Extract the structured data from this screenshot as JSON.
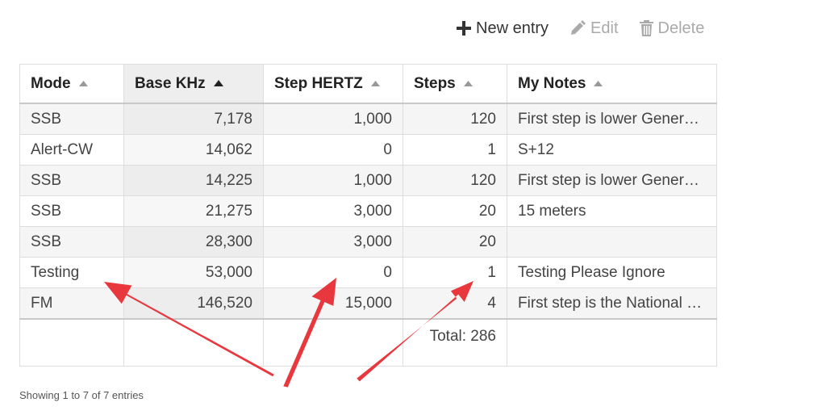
{
  "toolbar": {
    "new_entry": {
      "label": "New entry",
      "icon": "plus-icon"
    },
    "edit": {
      "label": "Edit",
      "icon": "pencil-icon"
    },
    "delete": {
      "label": "Delete",
      "icon": "trash-icon"
    }
  },
  "table": {
    "columns": [
      {
        "label": "Mode",
        "sort": "none"
      },
      {
        "label": "Base KHz",
        "sort": "ascending"
      },
      {
        "label": "Step HERTZ",
        "sort": "none"
      },
      {
        "label": "Steps",
        "sort": "none"
      },
      {
        "label": "My Notes",
        "sort": "none"
      }
    ],
    "rows": [
      {
        "mode": "SSB",
        "base": "7,178",
        "step": "1,000",
        "steps": "120",
        "notes": "First step is lower General Band Edge"
      },
      {
        "mode": "Alert-CW",
        "base": "14,062",
        "step": "0",
        "steps": "1",
        "notes": "S+12"
      },
      {
        "mode": "SSB",
        "base": "14,225",
        "step": "1,000",
        "steps": "120",
        "notes": "First step is lower General Band Edge"
      },
      {
        "mode": "SSB",
        "base": "21,275",
        "step": "3,000",
        "steps": "20",
        "notes": "15 meters"
      },
      {
        "mode": "SSB",
        "base": "28,300",
        "step": "3,000",
        "steps": "20",
        "notes": ""
      },
      {
        "mode": "Testing",
        "base": "53,000",
        "step": "0",
        "steps": "1",
        "notes": "Testing Please Ignore"
      },
      {
        "mode": "FM",
        "base": "146,520",
        "step": "15,000",
        "steps": "4",
        "notes": "First step is the National Simplex Frequency"
      }
    ],
    "footer": {
      "steps_total": "Total: 286"
    }
  },
  "info": "Showing 1 to 7 of 7 entries",
  "colors": {
    "arrow": "#e8383d",
    "sorted_header": "#eeeeee"
  }
}
